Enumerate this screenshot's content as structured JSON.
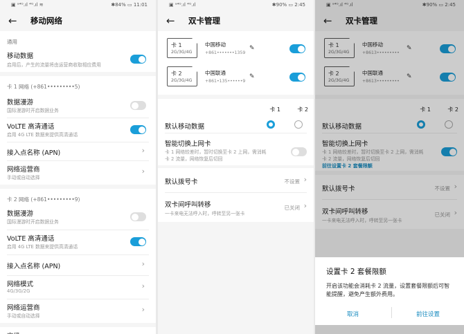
{
  "panel1": {
    "status": {
      "left": "▣ ᵃ⁴ᴳ.ıl ⁴ᴳ.ıl ≋",
      "battery": "✱84% ▭ 11:01"
    },
    "title": "移动网络",
    "general": {
      "label": "通用",
      "mobile_data": {
        "title": "移动数据",
        "sub": "启用后，产生的流量将由运营商收取相应费用",
        "on": true
      }
    },
    "sim1": {
      "label": "卡 1 网络 (+861•••••••••5)",
      "roaming": {
        "title": "数据漫游",
        "sub": "国际漫游时开启数据业务",
        "on": false
      },
      "volte": {
        "title": "VoLTE 高清通话",
        "sub": "启用 4G LTE 数据来提供高清通话",
        "on": true
      },
      "apn": "接入点名称 (APN)",
      "carrier": {
        "title": "网络运营商",
        "sub": "手动或自动选择"
      }
    },
    "sim2": {
      "label": "卡 2 网络 (+861•••••••••9)",
      "roaming": {
        "title": "数据漫游",
        "sub": "国际漫游时开启数据业务",
        "on": false
      },
      "volte": {
        "title": "VoLTE 高清通话",
        "sub": "启用 4G LTE 数据来提供高清通话",
        "on": true
      },
      "apn": "接入点名称 (APN)",
      "mode": {
        "title": "网络模式",
        "sub": "4G/3G/2G"
      },
      "carrier": {
        "title": "网络运营商",
        "sub": "手动或自动选择"
      }
    },
    "advanced": "高级"
  },
  "panel2": {
    "status": {
      "left": "▣ ᵃ⁴ᴳ.ıl ⁴ᴳ.ıl",
      "battery": "✱90% ▭ 2:45"
    },
    "title": "双卡管理",
    "cards": [
      {
        "sim": "卡 1",
        "net": "2G/3G/4G",
        "operator": "中国移动",
        "number": "+861•••••••1359",
        "on": true
      },
      {
        "sim": "卡 2",
        "net": "2G/3G/4G",
        "operator": "中国联通",
        "number": "+861•135••••••9",
        "on": true
      }
    ],
    "col1": "卡 1",
    "col2": "卡 2",
    "default_data": "默认移动数据",
    "smart": {
      "title": "智能切换上网卡",
      "sub1": "卡 1 网络较差时，暂时切换至卡 2 上网，需消耗",
      "sub2": "卡 2 流量，网络恢复后切回",
      "on": false
    },
    "dial": {
      "title": "默认拨号卡",
      "value": "不设置"
    },
    "forward": {
      "title": "双卡间呼叫转移",
      "sub": "一卡来电无法呼入时，呼转至另一张卡",
      "value": "已关闭"
    }
  },
  "panel3": {
    "status": {
      "left": "▣ ᵃ⁴ᴳ.ıl ⁴ᴳ.ıl",
      "battery": "✱90% ▭ 2:45"
    },
    "title": "双卡管理",
    "cards": [
      {
        "sim": "卡 1",
        "net": "2G/3G/4G",
        "operator": "中国移动",
        "number": "+8613•••••••••",
        "on": true
      },
      {
        "sim": "卡 2",
        "net": "2G/3G/4G",
        "operator": "中国联通",
        "number": "+8613•••••••••",
        "on": true
      }
    ],
    "col1": "卡 1",
    "col2": "卡 2",
    "default_data": "默认移动数据",
    "smart": {
      "title": "智能切换上网卡",
      "sub1": "卡 1 网络较差时，暂时切换至卡 2 上网，需消耗",
      "sub2": "卡 2 流量，网络恢复后切回",
      "link": "前往设置卡 2 套餐限额",
      "on": true
    },
    "dial": {
      "title": "默认拨号卡",
      "value": "不设置"
    },
    "forward": {
      "title": "双卡间呼叫转移",
      "sub": "一卡来电无法呼入时，呼转至另一张卡",
      "value": "已关闭"
    },
    "dialog": {
      "title": "设置卡 2 套餐限额",
      "body": "开启该功能会消耗卡 2 流量，设置套餐限额后可智能提醒，避免产生额外费用。",
      "cancel": "取消",
      "confirm": "前往设置"
    }
  },
  "colors": {
    "accent": "#1a9ed9",
    "link": "#1a8cc0"
  }
}
